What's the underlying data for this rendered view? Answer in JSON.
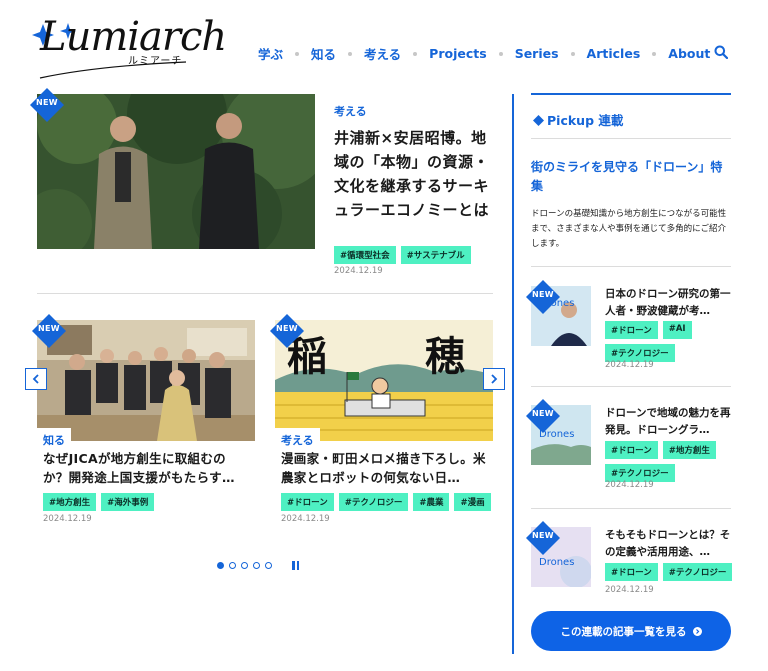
{
  "header": {
    "logo_text": "Lumiarch",
    "logo_kana": "ルミアーチ",
    "nav": [
      "学ぶ",
      "知る",
      "考える",
      "Projects",
      "Series",
      "Articles",
      "About"
    ]
  },
  "badge_label": "NEW",
  "featured": {
    "category": "考える",
    "title": "井浦新×安居昭博。地域の「本物」の資源・文化を継承するサーキュラーエコノミーとは",
    "tags": [
      "#循環型社会",
      "#サステナブル"
    ],
    "date": "2024.12.19"
  },
  "cards": [
    {
      "category": "知る",
      "title": "なぜJICAが地方創生に取組むのか？開発途上国支援がもたらす…",
      "tags": [
        "#地方創生",
        "#海外事例"
      ],
      "date": "2024.12.19"
    },
    {
      "category": "考える",
      "title": "漫画家・町田メロメ描き下ろし。米農家とロボットの何気ない日…",
      "tags": [
        "#ドローン",
        "#テクノロジー",
        "#農業",
        "#漫画"
      ],
      "date": "2024.12.19",
      "image_text": [
        "稲",
        "穂"
      ]
    }
  ],
  "carousel": {
    "slides": 5,
    "active": 1
  },
  "sidebar": {
    "title": "Pickup 連載",
    "feature_title": "街のミライを見守る「ドローン」特集",
    "feature_desc": "ドローンの基礎知識から地方創生につながる可能性まで、さまざまな人や事例を通じて多角的にご紹介します。",
    "items": [
      {
        "title": "日本のドローン研究の第一人者・野波健蔵が考…",
        "tags": [
          "#ドローン",
          "#AI",
          "#テクノロジー"
        ],
        "date": "2024.12.19"
      },
      {
        "title": "ドローンで地域の魅力を再発見。ドローングラ…",
        "tags": [
          "#ドローン",
          "#地方創生",
          "#テクノロジー"
        ],
        "date": "2024.12.19"
      },
      {
        "title": "そもそもドローンとは？その定義や活用用途、…",
        "tags": [
          "#ドローン",
          "#テクノロジー"
        ],
        "date": "2024.12.19"
      }
    ],
    "thumb_label": "Drones",
    "cta_label": "この連載の記事一覧を見る"
  },
  "colors": {
    "accent": "#1565d8",
    "tag": "#4ef0c2"
  }
}
